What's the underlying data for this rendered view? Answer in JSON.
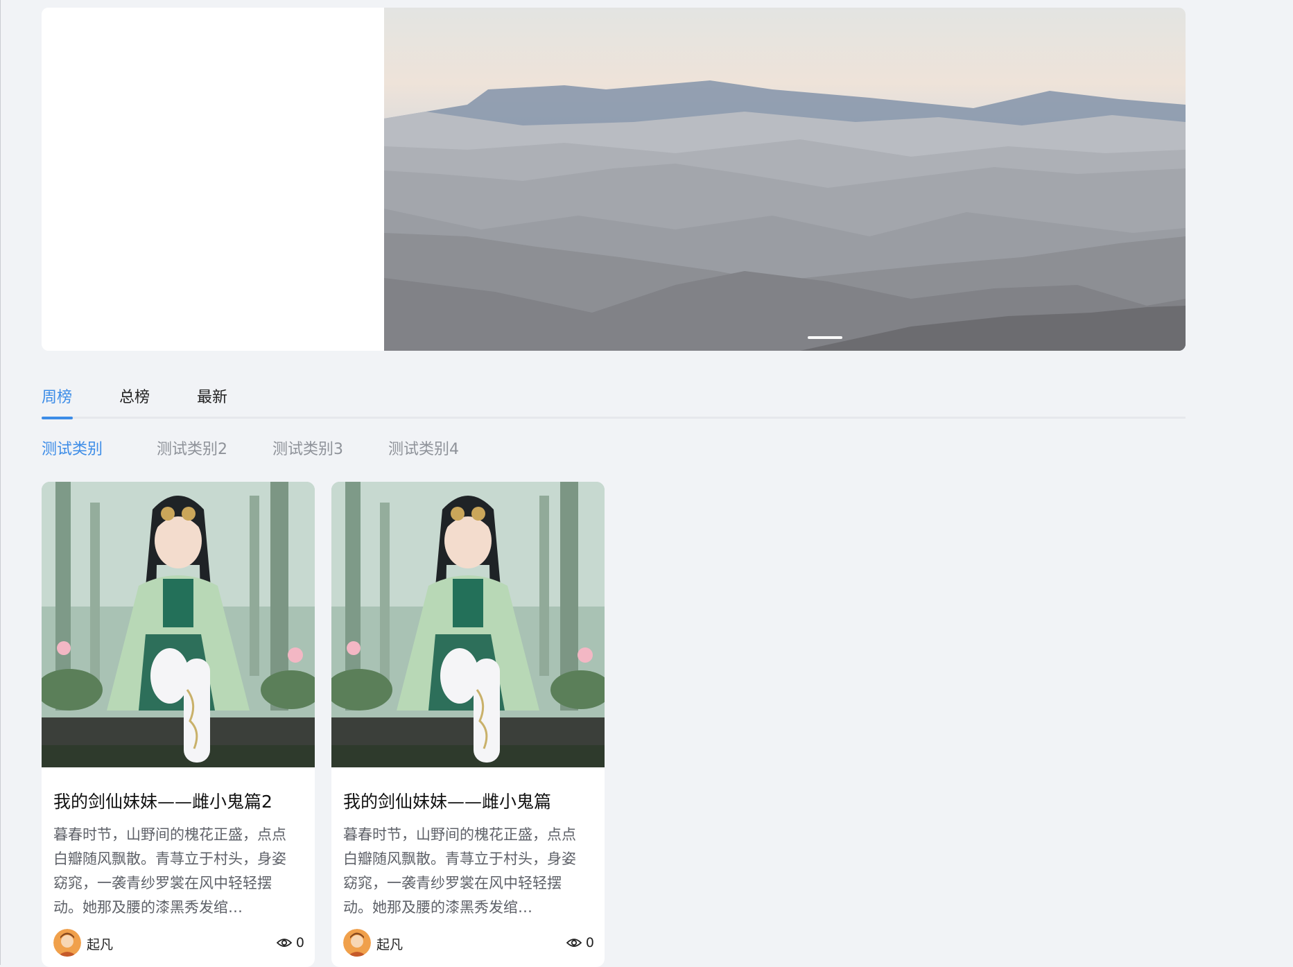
{
  "banner": {
    "active_slide": 1,
    "slide_count": 1
  },
  "tabs": [
    {
      "label": "周榜",
      "active": true
    },
    {
      "label": "总榜",
      "active": false
    },
    {
      "label": "最新",
      "active": false
    }
  ],
  "categories": [
    {
      "label": "测试类别",
      "active": true
    },
    {
      "label": "测试类别2",
      "active": false
    },
    {
      "label": "测试类别3",
      "active": false
    },
    {
      "label": "测试类别4",
      "active": false
    }
  ],
  "cards": [
    {
      "title": "我的剑仙妹妹——雌小鬼篇2",
      "summary": "暮春时节，山野间的槐花正盛，点点白瓣随风飘散。青荨立于村头，身姿窈窕，一袭青纱罗裳在风中轻轻摆动。她那及腰的漆黑秀发绾…",
      "author": "起凡",
      "views": "0"
    },
    {
      "title": "我的剑仙妹妹——雌小鬼篇",
      "summary": "暮春时节，山野间的槐花正盛，点点白瓣随风飘散。青荨立于村头，身姿窈窕，一袭青纱罗裳在风中轻轻摆动。她那及腰的漆黑秀发绾…",
      "author": "起凡",
      "views": "0"
    }
  ],
  "colors": {
    "accent": "#3c8ce7",
    "background": "#f1f3f6"
  },
  "icons": {
    "views": "eye-icon",
    "avatar": "user-avatar"
  }
}
